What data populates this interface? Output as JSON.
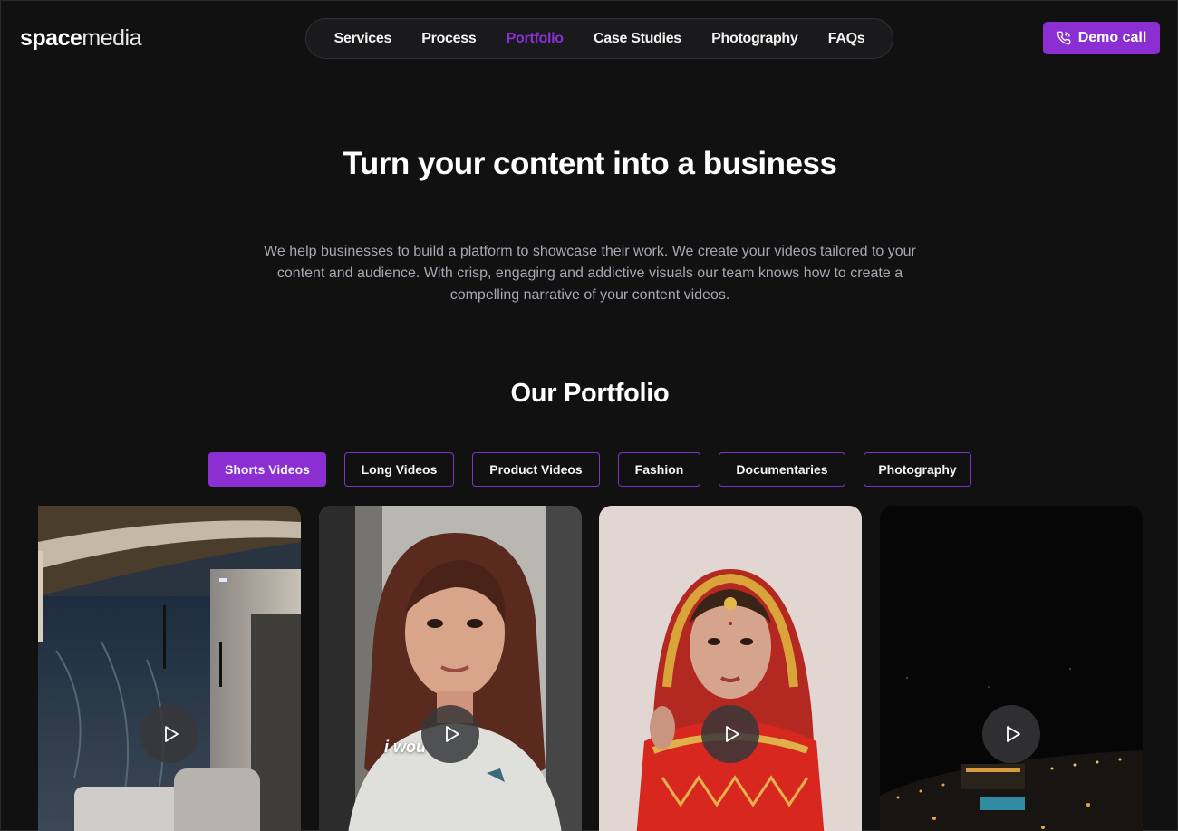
{
  "logo": {
    "bold": "space",
    "light": "media"
  },
  "nav": {
    "items": [
      {
        "label": "Services"
      },
      {
        "label": "Process"
      },
      {
        "label": "Portfolio",
        "active": true
      },
      {
        "label": "Case Studies"
      },
      {
        "label": "Photography"
      },
      {
        "label": "FAQs"
      }
    ]
  },
  "cta": {
    "label": "Demo call",
    "icon": "phone-icon"
  },
  "hero": {
    "title": "Turn your content into a business",
    "description": "We help businesses to build a platform to showcase their work. We create your videos tailored to your content and audience. With crisp, engaging and addictive visuals our team knows how to create a compelling narrative of your content videos."
  },
  "portfolio": {
    "title": "Our Portfolio",
    "filters": [
      {
        "label": "Shorts Videos",
        "active": true
      },
      {
        "label": "Long Videos"
      },
      {
        "label": "Product Videos"
      },
      {
        "label": "Fashion"
      },
      {
        "label": "Documentaries"
      },
      {
        "label": "Photography"
      }
    ],
    "videos": [
      {
        "subject": "interior room",
        "caption": ""
      },
      {
        "subject": "woman talking",
        "caption": "i wou"
      },
      {
        "subject": "bride portrait",
        "caption": ""
      },
      {
        "subject": "night city aerial",
        "caption": ""
      }
    ]
  },
  "colors": {
    "background": "#121112",
    "accent": "#8b2fd3",
    "muted_text": "#a6a8b2"
  }
}
